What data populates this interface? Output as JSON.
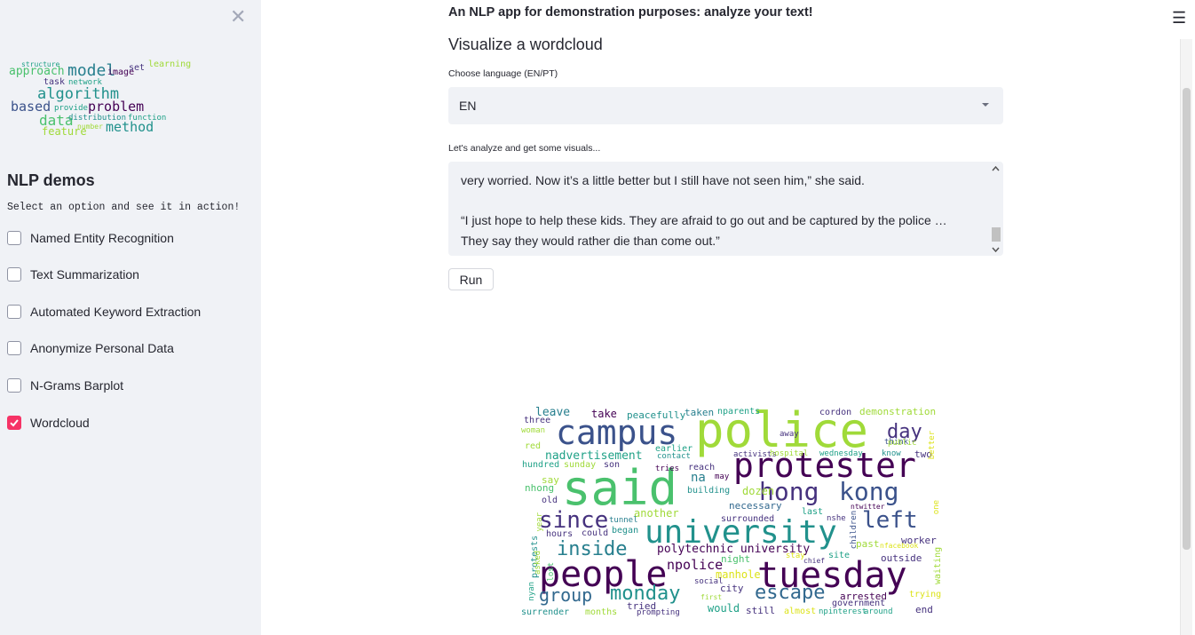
{
  "sidebar": {
    "title": "NLP demos",
    "subtitle": "Select an option and see it in action!",
    "options": [
      {
        "label": "Named Entity Recognition",
        "checked": false
      },
      {
        "label": "Text Summarization",
        "checked": false
      },
      {
        "label": "Automated Keyword Extraction",
        "checked": false
      },
      {
        "label": "Anonymize Personal Data",
        "checked": false
      },
      {
        "label": "N-Grams Barplot",
        "checked": false
      },
      {
        "label": "Wordcloud",
        "checked": true
      }
    ],
    "logo_words": [
      "structure",
      "approach",
      "model",
      "image",
      "algorithm",
      "task",
      "network",
      "learning",
      "based",
      "problem",
      "data",
      "distribution",
      "provide",
      "function",
      "feature",
      "method",
      "number",
      "set"
    ]
  },
  "main": {
    "heading": "An NLP app for demonstration purposes: analyze your text!",
    "subheading": "Visualize a wordcloud",
    "language_label": "Choose language (EN/PT)",
    "language_value": "EN",
    "text_label": "Let's analyze and get some visuals...",
    "text_lines": [
      "very worried. Now it’s a little better but I still have not seen him,” she said.",
      "",
      "“I just hope to help these kids. They are afraid to go out and be captured by the police …",
      "They say they would rather die than come out.”"
    ],
    "run_label": "Run"
  },
  "wordcloud_words": [
    "police",
    "said",
    "protester",
    "campus",
    "university",
    "tuesday",
    "people",
    "hong",
    "kong",
    "left",
    "since",
    "escape",
    "monday",
    "group",
    "inside",
    "day",
    "polytechnic university",
    "npolice",
    "nadvertisement",
    "leave",
    "take",
    "peacefully",
    "taken",
    "nparents",
    "cordon",
    "demonstration",
    "two",
    "think",
    "better",
    "public",
    "away",
    "know",
    "wednesday",
    "activists",
    "earlier",
    "contact",
    "tries",
    "reach",
    "may",
    "na",
    "building",
    "dozen",
    "necessary",
    "surrounded",
    "last",
    "nshe",
    "children",
    "ntwitter",
    "one",
    "another",
    "tunnel",
    "began",
    "could",
    "hours",
    "night",
    "stay",
    "chief",
    "site",
    "outside",
    "worker",
    "past",
    "nfacebook",
    "waiting",
    "manhole",
    "social",
    "first",
    "city",
    "would",
    "still",
    "almost",
    "npinterest",
    "arrested",
    "government",
    "around",
    "end",
    "trying",
    "tried",
    "prompting",
    "months",
    "surrender",
    "nyan",
    "protests",
    "asked",
    "lost",
    "year",
    "old",
    "nhong",
    "say",
    "sunday",
    "son",
    "hundred",
    "red",
    "three",
    "woman",
    "hospital"
  ],
  "colors": {
    "accent": "#f63366",
    "sidebar_bg": "#f0f2f6"
  },
  "icons": {
    "close": "close-icon",
    "menu": "hamburger-menu-icon",
    "caret": "chevron-down-icon",
    "check": "check-icon"
  }
}
